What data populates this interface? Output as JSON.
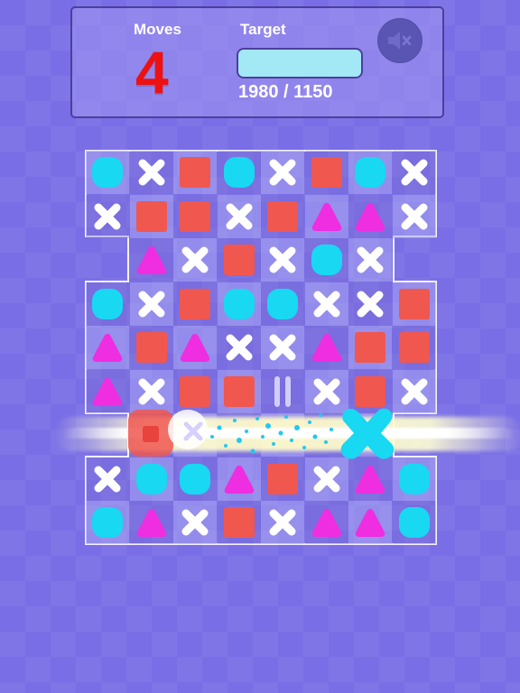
{
  "hud": {
    "moves_label": "Moves",
    "moves_value": "4",
    "target_label": "Target",
    "score_text": "1980 / 1150",
    "target_progress": 1.0,
    "mute_icon": "speaker-muted-icon"
  },
  "colors": {
    "background": "#7a6ee6",
    "circle": "#18d8f2",
    "cross": "#ffffff",
    "square": "#f0574f",
    "triangle": "#ee2ee0"
  },
  "board": {
    "rows": [
      [
        "circle",
        "cross",
        "square",
        "circle",
        "cross",
        "square",
        "circle",
        "cross"
      ],
      [
        "cross",
        "square",
        "square",
        "cross",
        "square",
        "triangle",
        "triangle",
        "cross"
      ],
      [
        null,
        "triangle",
        "cross",
        "square",
        "cross",
        "circle",
        "cross",
        null
      ],
      [
        "circle",
        "cross",
        "square",
        "circle",
        "circle",
        "cross",
        "cross",
        "square"
      ],
      [
        "triangle",
        "square",
        "triangle",
        "cross",
        "cross",
        "triangle",
        "square",
        "square"
      ],
      [
        "triangle",
        "cross",
        "square",
        "square",
        "ghost",
        "cross",
        "square",
        "cross"
      ],
      [
        null,
        null,
        null,
        null,
        null,
        null,
        null,
        null
      ],
      [
        "cross",
        "circle",
        "circle",
        "triangle",
        "square",
        "cross",
        "triangle",
        "circle"
      ],
      [
        "circle",
        "triangle",
        "cross",
        "square",
        "cross",
        "triangle",
        "triangle",
        "circle"
      ]
    ]
  }
}
